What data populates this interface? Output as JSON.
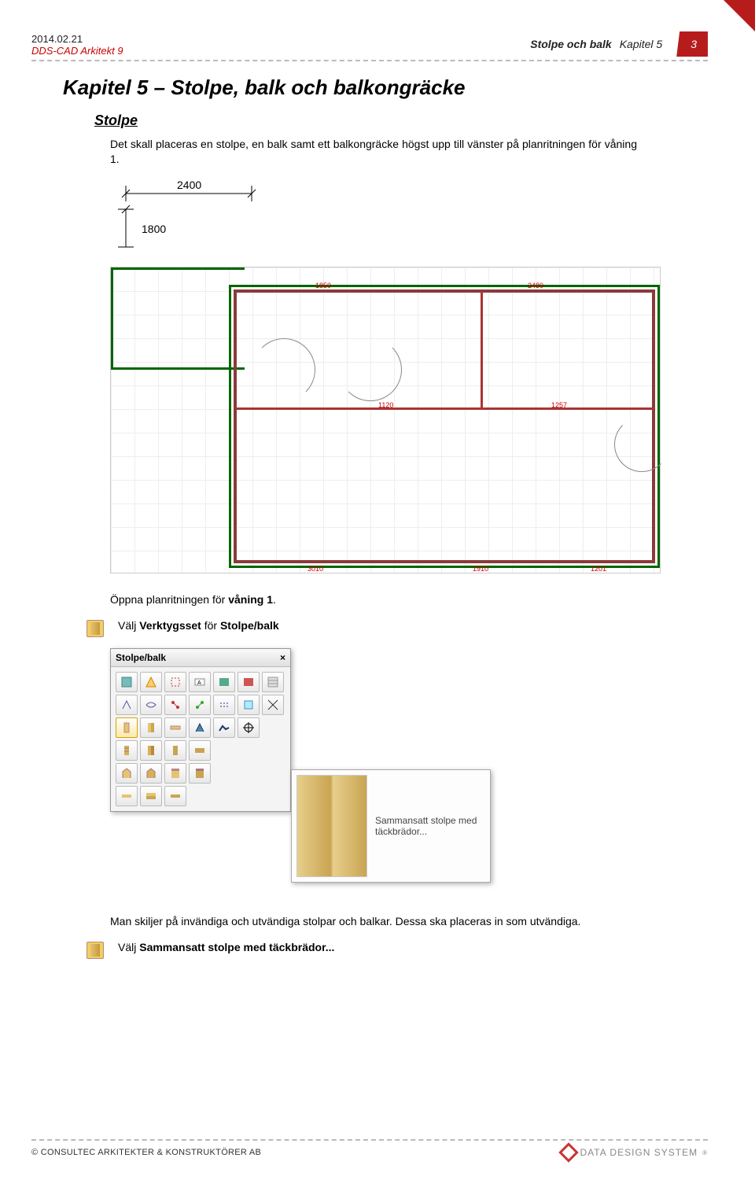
{
  "header": {
    "date": "2014.02.21",
    "product": "DDS-CAD Arkitekt 9",
    "doc_title": "Stolpe och balk",
    "chapter_ref": "Kapitel 5",
    "page_num": "3"
  },
  "headings": {
    "h1": "Kapitel 5  – Stolpe, balk och balkongräcke",
    "h2": "Stolpe"
  },
  "paragraphs": {
    "intro": "Det skall placeras en stolpe, en balk samt ett balkongräcke högst upp till vänster på planritningen för våning 1.",
    "open_plan_pre": "Öppna planritningen för ",
    "open_plan_bold": "våning 1",
    "open_plan_post": ".",
    "select_tool_pre": "Välj ",
    "select_tool_bold1": "Verktygsset",
    "select_tool_mid": " för ",
    "select_tool_bold2": "Stolpe/balk",
    "distinguish": "Man skiljer på invändiga och utvändiga stolpar och balkar. Dessa ska placeras in som utvändiga.",
    "select_stolpe_pre": "Välj ",
    "select_stolpe_bold": "Sammansatt stolpe med täckbrädor..."
  },
  "dimensions": {
    "horiz": "2400",
    "vert": "1800"
  },
  "palette": {
    "title": "Stolpe/balk"
  },
  "tooltip": {
    "text": "Sammansatt stolpe med täckbrädor..."
  },
  "footer": {
    "copyright": "©  CONSULTEC ARKITEKTER & KONSTRUKTÖRER AB",
    "brand": "DATA DESIGN SYSTEM"
  },
  "floorplan_dims_small": {
    "a": "1850",
    "b": "2480",
    "c": "1120",
    "d": "1257",
    "e": "3010",
    "f": "1910",
    "g": "1201"
  }
}
